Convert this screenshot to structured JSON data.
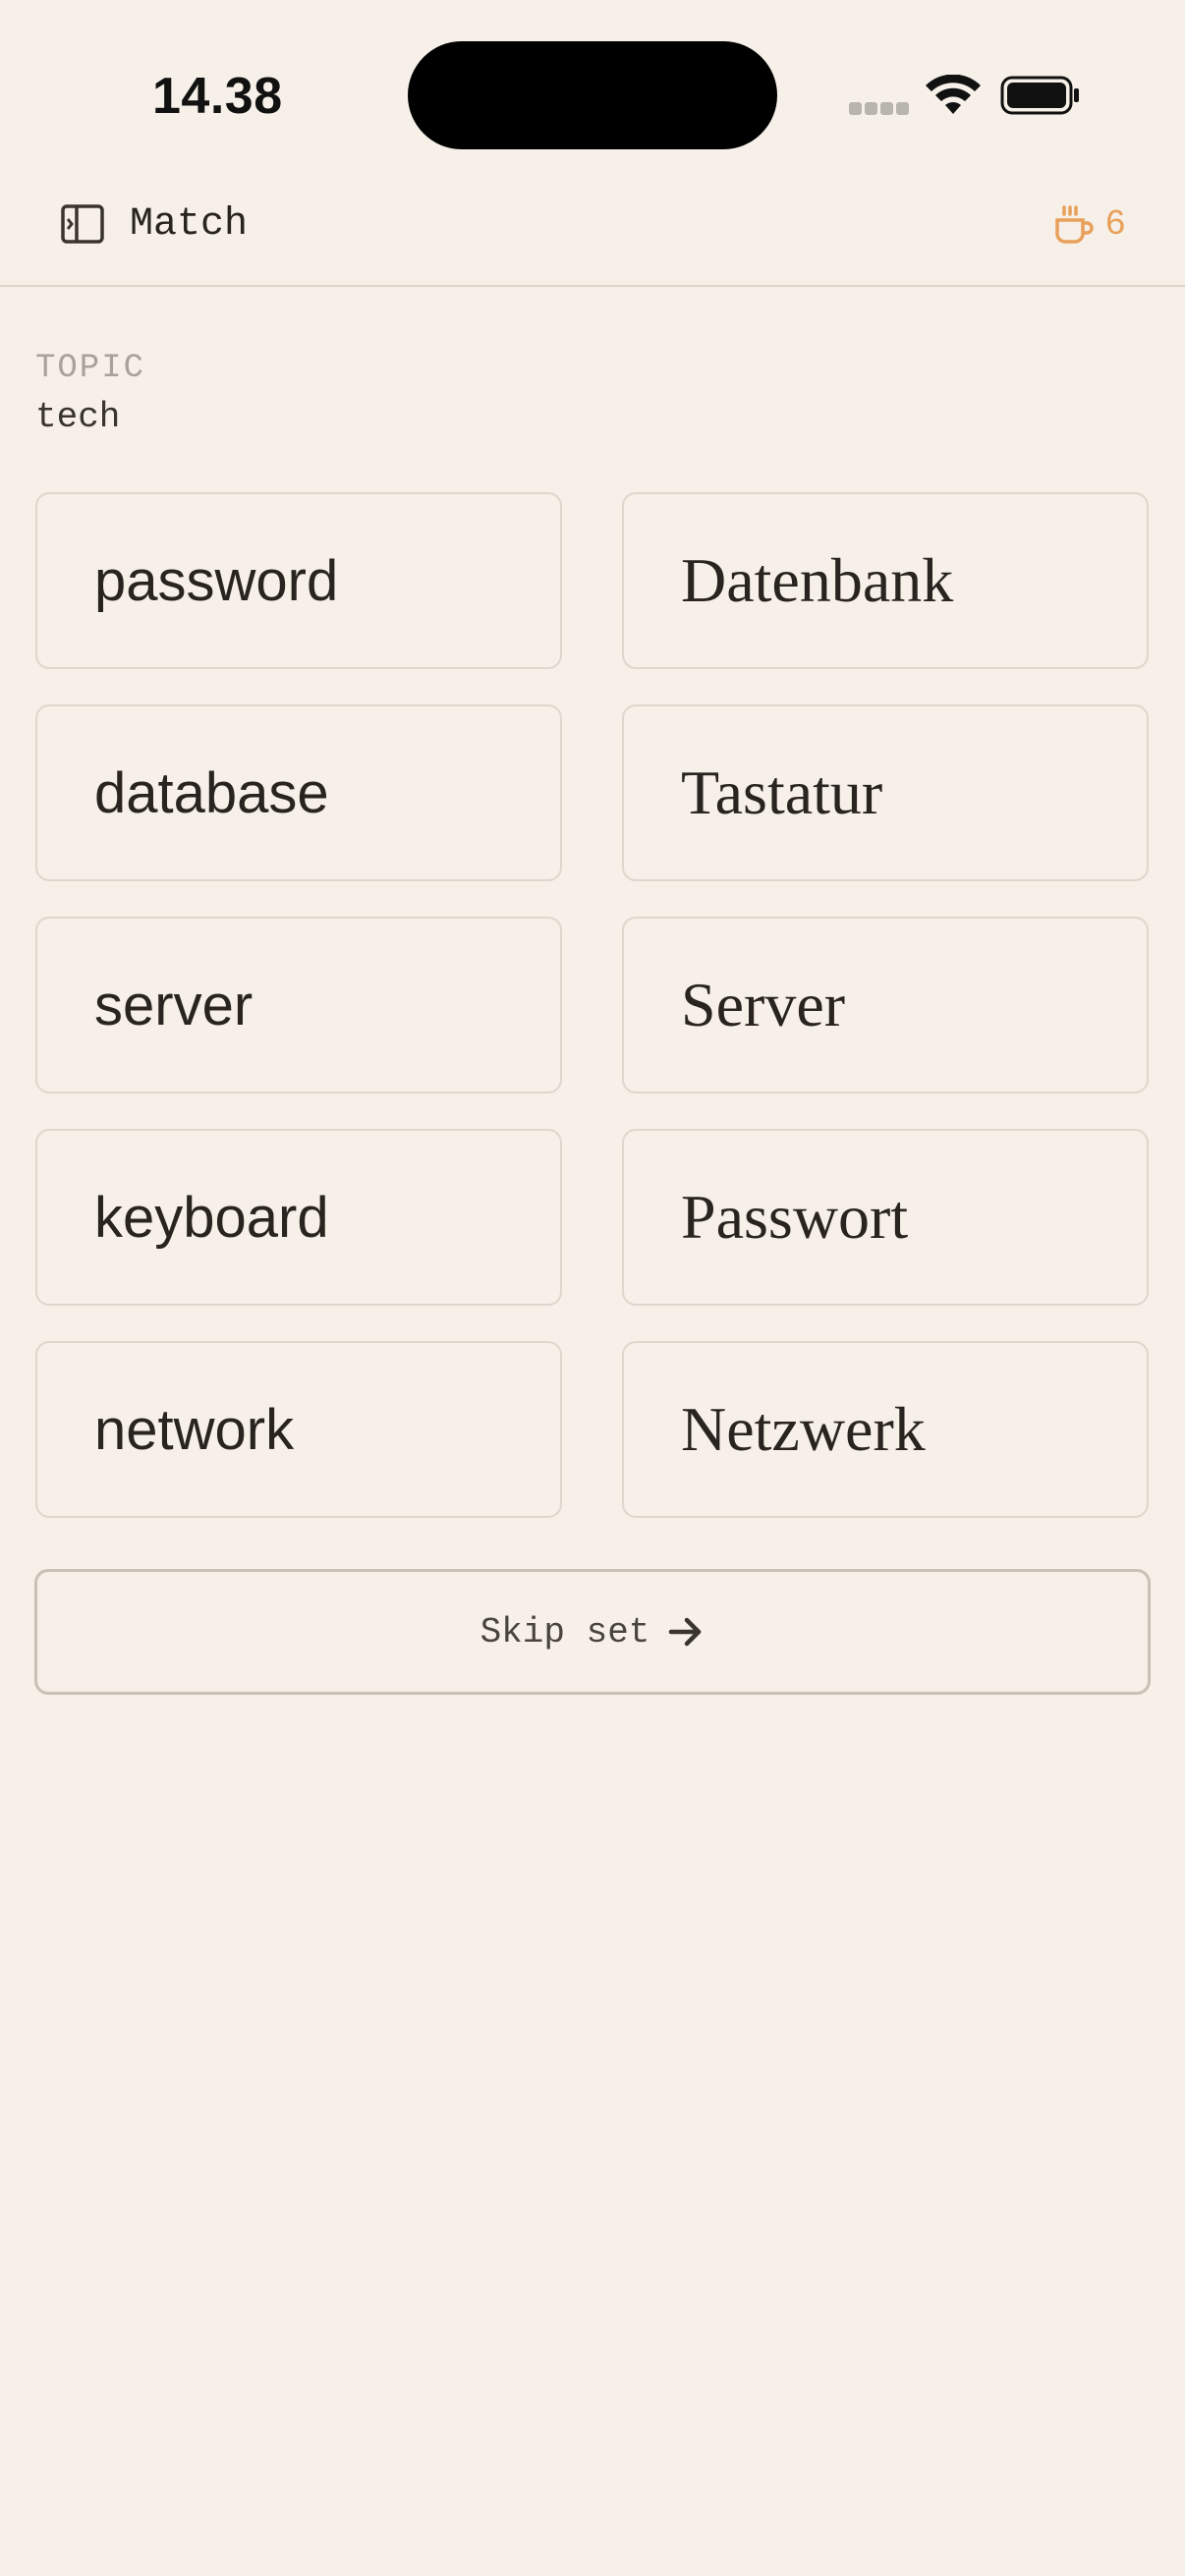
{
  "status_bar": {
    "time": "14.38",
    "icons": [
      "signal-dots-icon",
      "wifi-icon",
      "battery-icon"
    ]
  },
  "header": {
    "title": "Match",
    "streak_count": "6",
    "icons": [
      "sidebar-toggle-icon",
      "coffee-cup-icon"
    ],
    "accent_color": "#e8a05a"
  },
  "topic": {
    "label": "TOPIC",
    "value": "tech"
  },
  "cards": {
    "left": [
      "password",
      "database",
      "server",
      "keyboard",
      "network"
    ],
    "right": [
      "Datenbank",
      "Tastatur",
      "Server",
      "Passwort",
      "Netzwerk"
    ]
  },
  "skip": {
    "label": "Skip set",
    "icon": "arrow-right-icon"
  },
  "colors": {
    "background": "#f6f0e8",
    "text": "#2a2420",
    "border": "#ddd7cd"
  }
}
